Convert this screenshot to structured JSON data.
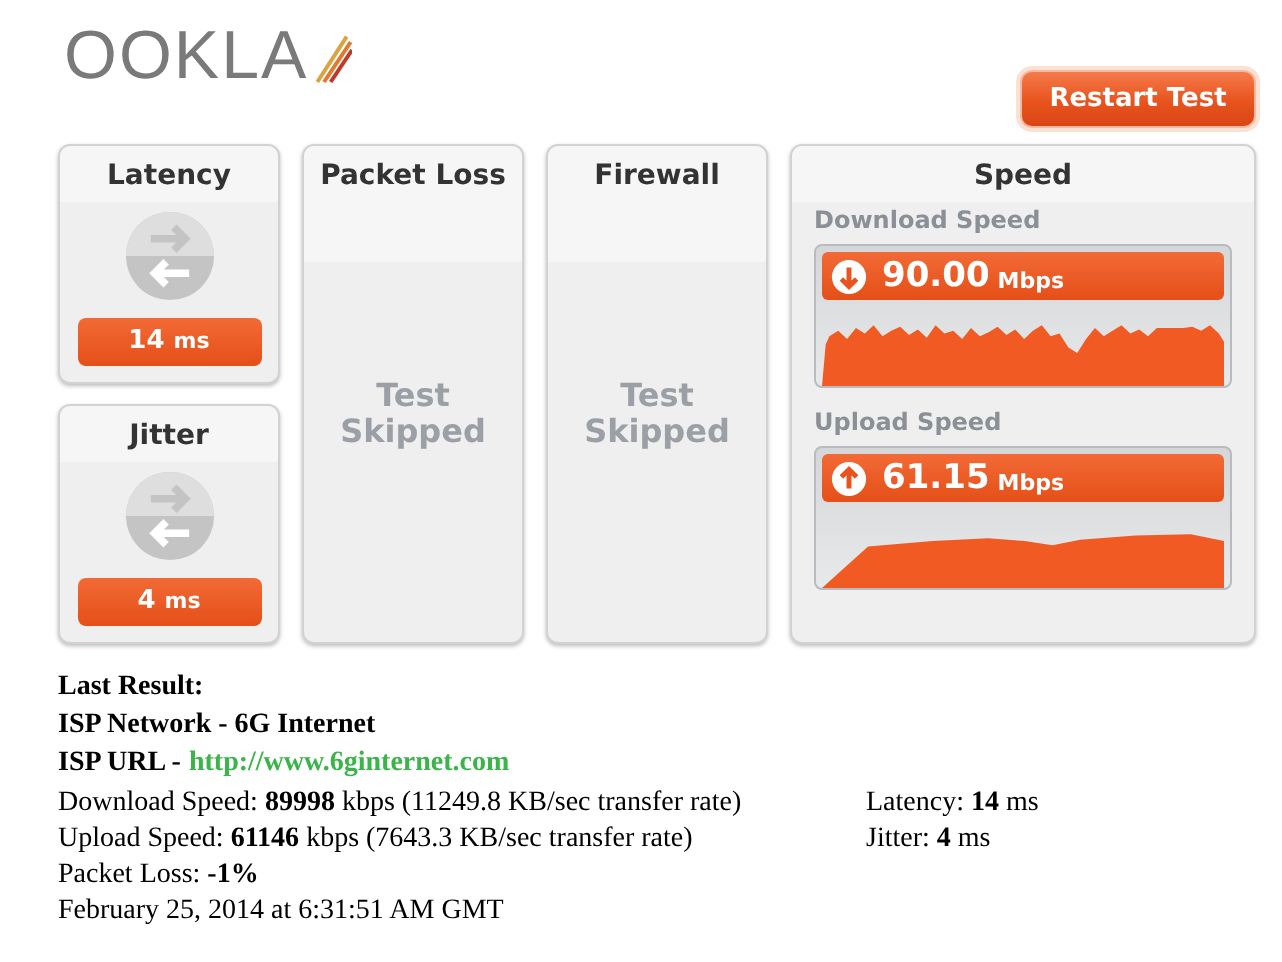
{
  "logo": {
    "text": "OOKLA"
  },
  "restart_button": {
    "label": "Restart Test"
  },
  "metrics": [
    {
      "title": "Latency",
      "value": "14",
      "unit": "ms"
    },
    {
      "title": "Jitter",
      "value": "4",
      "unit": "ms"
    }
  ],
  "tests": [
    {
      "title": "Packet Loss",
      "status": "Test Skipped"
    },
    {
      "title": "Firewall",
      "status": "Test Skipped"
    }
  ],
  "speed": {
    "title": "Speed",
    "items": [
      {
        "kind": "download",
        "label": "Download Speed",
        "value": "90.00",
        "unit": "Mbps"
      },
      {
        "kind": "upload",
        "label": "Upload Speed",
        "value": "61.15",
        "unit": "Mbps"
      }
    ]
  },
  "last_result": {
    "title": "Last Result:",
    "isp_network": "ISP Network - 6G Internet",
    "isp_url_label": "ISP URL -",
    "isp_url": "http://www.6ginternet.com",
    "speed_lines": [
      "Download Speed: **89998** kbps (11249.8 KB/sec transfer rate)",
      "Upload Speed: **61146** kbps (7643.3 KB/sec transfer rate)"
    ],
    "metric_lines": [
      "Latency: **14** ms",
      "Jitter: **4** ms"
    ],
    "packet_loss": "Packet Loss: **-1%**",
    "date": "February 25, 2014 at 6:31:51 AM GMT"
  }
}
